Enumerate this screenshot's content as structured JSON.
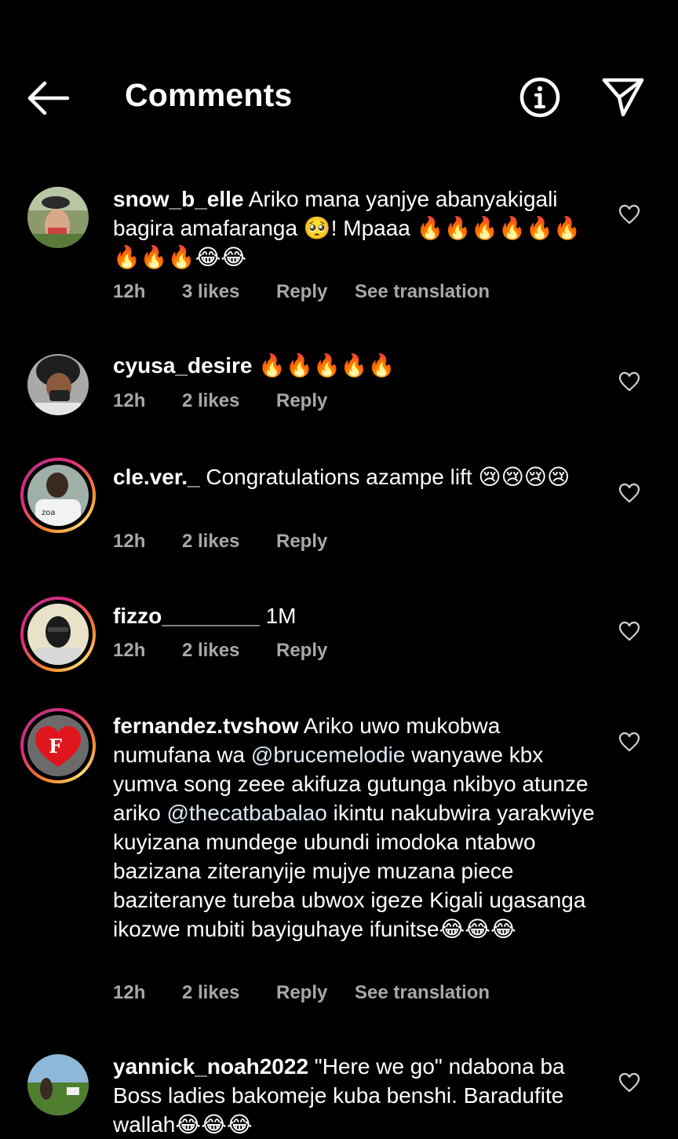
{
  "header": {
    "title": "Comments",
    "back_icon": "arrow-left-icon",
    "info_icon": "info-icon",
    "share_icon": "paper-plane-icon"
  },
  "scroll_remnant": "· · ·",
  "comments": [
    {
      "username": "snow_b_elle",
      "text": " Ariko mana yanjye abanyakigali bagira amafaranga 🥺! Mpaaa 🔥🔥🔥🔥🔥🔥🔥🔥🔥😂😂",
      "time": "12h",
      "likes": "3 likes",
      "reply": "Reply",
      "translation": "See translation"
    },
    {
      "username": "cyusa_desire",
      "text": " 🔥🔥🔥🔥🔥",
      "time": "12h",
      "likes": "2 likes",
      "reply": "Reply"
    },
    {
      "username": "cle.ver._",
      "text": " Congratulations azampe lift 😢😢😢😢",
      "time": "12h",
      "likes": "2 likes",
      "reply": "Reply"
    },
    {
      "username": "fizzo________",
      "text": " 1M",
      "time": "12h",
      "likes": "2 likes",
      "reply": "Reply"
    },
    {
      "username": "fernandez.tvshow",
      "text_before": " Ariko uwo mukobwa numufana wa ",
      "mention_1": "@brucemelodie",
      "text_middle": " wanyawe kbx yumva song zeee akifuza gutunga nkibyo atunze ariko ",
      "mention_2": "@thecatbabalao",
      "text_after": " ikintu nakubwira yarakwiye kuyizana mundege ubundi imodoka ntabwo bazizana ziteranyije mujye muzana piece baziteranye tureba ubwox igeze Kigali ugasanga ikozwe mubiti bayiguhaye  ifunitse😂😂😂",
      "time": "12h",
      "likes": "2 likes",
      "reply": "Reply",
      "translation": "See translation"
    },
    {
      "username": "yannick_noah2022",
      "text": " \"Here we go\" ndabona ba Boss ladies bakomeje kuba benshi. Baradufite  wallah😂😂😂"
    }
  ],
  "icons": {
    "like": "heart-outline-icon"
  }
}
